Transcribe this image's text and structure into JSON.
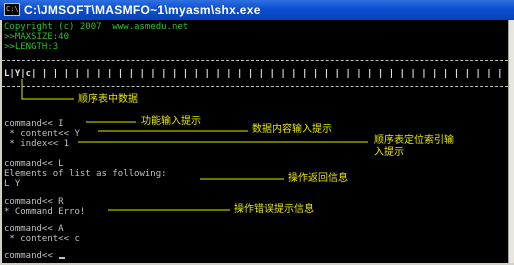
{
  "window": {
    "title": "C:\\JMSOFT\\MASMFO~1\\myasm\\shx.exe",
    "icon_label": "C:\\"
  },
  "console": {
    "header": [
      "Copyright (c) 2007  www.asmedu.net",
      ">>MAXSIZE:40",
      ">>LENGTH:3"
    ],
    "list_line": "L|Y|c| | | | | | | | | | | | | | | | | | | | | | | | | | | | | | | | | | | | | | | | | | | | | | | | |",
    "session": [
      "command<< I",
      " * content<< Y",
      " * index<< 1",
      "",
      "command<< L",
      "Elements of list as following:",
      "L Y",
      "",
      "command<< R",
      "* Command Erro!",
      "",
      "command<< A",
      " * content<< c",
      "",
      "command<< "
    ]
  },
  "annotations": {
    "list_data": "顺序表中数据",
    "function_input": "功能输入提示",
    "content_input": "数据内容输入提示",
    "index_input": "顺序表定位索引输\n入提示",
    "return_info": "操作返回信息",
    "error_info": "操作错误提示信息"
  },
  "colors": {
    "title_bar": "#0a4fd0",
    "console_background": "#000000",
    "console_text": "#c0c0c0",
    "header_text": "#27c427",
    "annotation_text": "#e6e600"
  }
}
